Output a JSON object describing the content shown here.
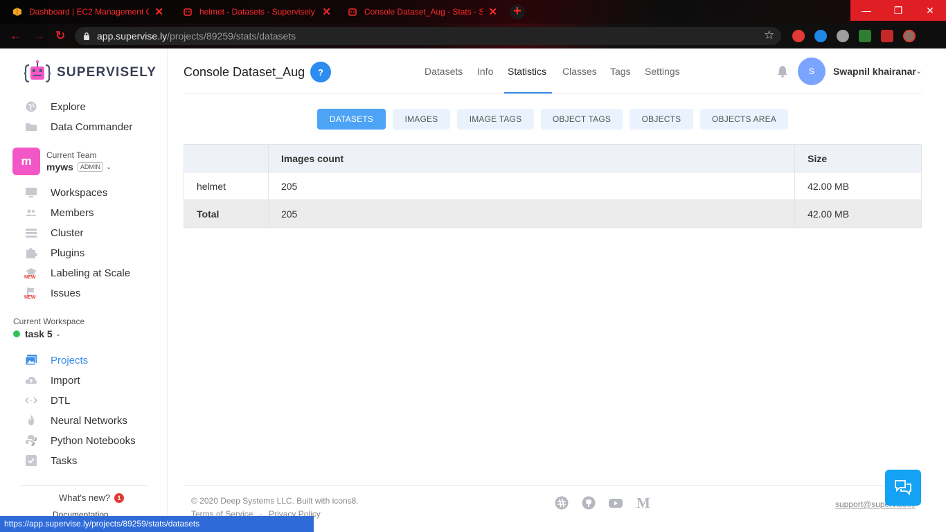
{
  "browser": {
    "tabs": [
      {
        "title": "Dashboard | EC2 Management C",
        "icon": "aws-box-icon"
      },
      {
        "title": "helmet - Datasets - Supervisely",
        "icon": "supervisely-icon"
      },
      {
        "title": "Console Dataset_Aug - Stats - Su",
        "icon": "supervisely-icon"
      }
    ],
    "url_host": "app.supervise.ly",
    "url_path": "/projects/89259/stats/datasets",
    "status_url": "https://app.supervise.ly/projects/89259/stats/datasets",
    "accent": "#ff2a2a"
  },
  "sidebar": {
    "brand": "SUPERVISELY",
    "top_items": [
      {
        "label": "Explore",
        "icon": "globe-icon"
      },
      {
        "label": "Data Commander",
        "icon": "folder-icon"
      }
    ],
    "team": {
      "caption": "Current Team",
      "avatar_letter": "m",
      "name": "myws",
      "role": "ADMIN"
    },
    "team_items": [
      {
        "label": "Workspaces",
        "icon": "monitor-icon"
      },
      {
        "label": "Members",
        "icon": "people-icon"
      },
      {
        "label": "Cluster",
        "icon": "server-icon"
      },
      {
        "label": "Plugins",
        "icon": "puzzle-icon"
      },
      {
        "label": "Labeling at Scale",
        "icon": "graduation-cap-icon",
        "tag": "NEW"
      },
      {
        "label": "Issues",
        "icon": "flag-icon",
        "tag": "NEW"
      }
    ],
    "workspace": {
      "caption": "Current Workspace",
      "name": "task 5"
    },
    "ws_items": [
      {
        "label": "Projects",
        "icon": "images-icon",
        "active": true
      },
      {
        "label": "Import",
        "icon": "cloud-upload-icon"
      },
      {
        "label": "DTL",
        "icon": "code-icon"
      },
      {
        "label": "Neural Networks",
        "icon": "flame-icon"
      },
      {
        "label": "Python Notebooks",
        "icon": "python-icon"
      },
      {
        "label": "Tasks",
        "icon": "checkbox-icon"
      }
    ],
    "whats_new": {
      "label": "What's new?",
      "count": "1"
    },
    "documentation": "Documentation"
  },
  "header": {
    "title": "Console Dataset_Aug",
    "help": "?",
    "tabs": [
      "Datasets",
      "Info",
      "Statistics",
      "Classes",
      "Tags",
      "Settings"
    ],
    "active_tab": "Statistics",
    "user": {
      "initial": "s",
      "name": "Swapnil khairanar"
    }
  },
  "stats_tabs": [
    "DATASETS",
    "IMAGES",
    "IMAGE TAGS",
    "OBJECT TAGS",
    "OBJECTS",
    "OBJECTS AREA"
  ],
  "table": {
    "columns": [
      "",
      "Images count",
      "Size"
    ],
    "rows": [
      {
        "name": "helmet",
        "count": "205",
        "size": "42.00 MB"
      }
    ],
    "total": {
      "name": "Total",
      "count": "205",
      "size": "42.00 MB"
    }
  },
  "footer": {
    "copyright": "© 2020 Deep Systems LLC. Built with icons8.",
    "terms": "Terms of Service",
    "separator": "·",
    "privacy": "Privacy Policy",
    "support": "support@supervise.ly",
    "social_icons": [
      "slack-icon",
      "github-icon",
      "youtube-icon",
      "medium-icon"
    ]
  }
}
